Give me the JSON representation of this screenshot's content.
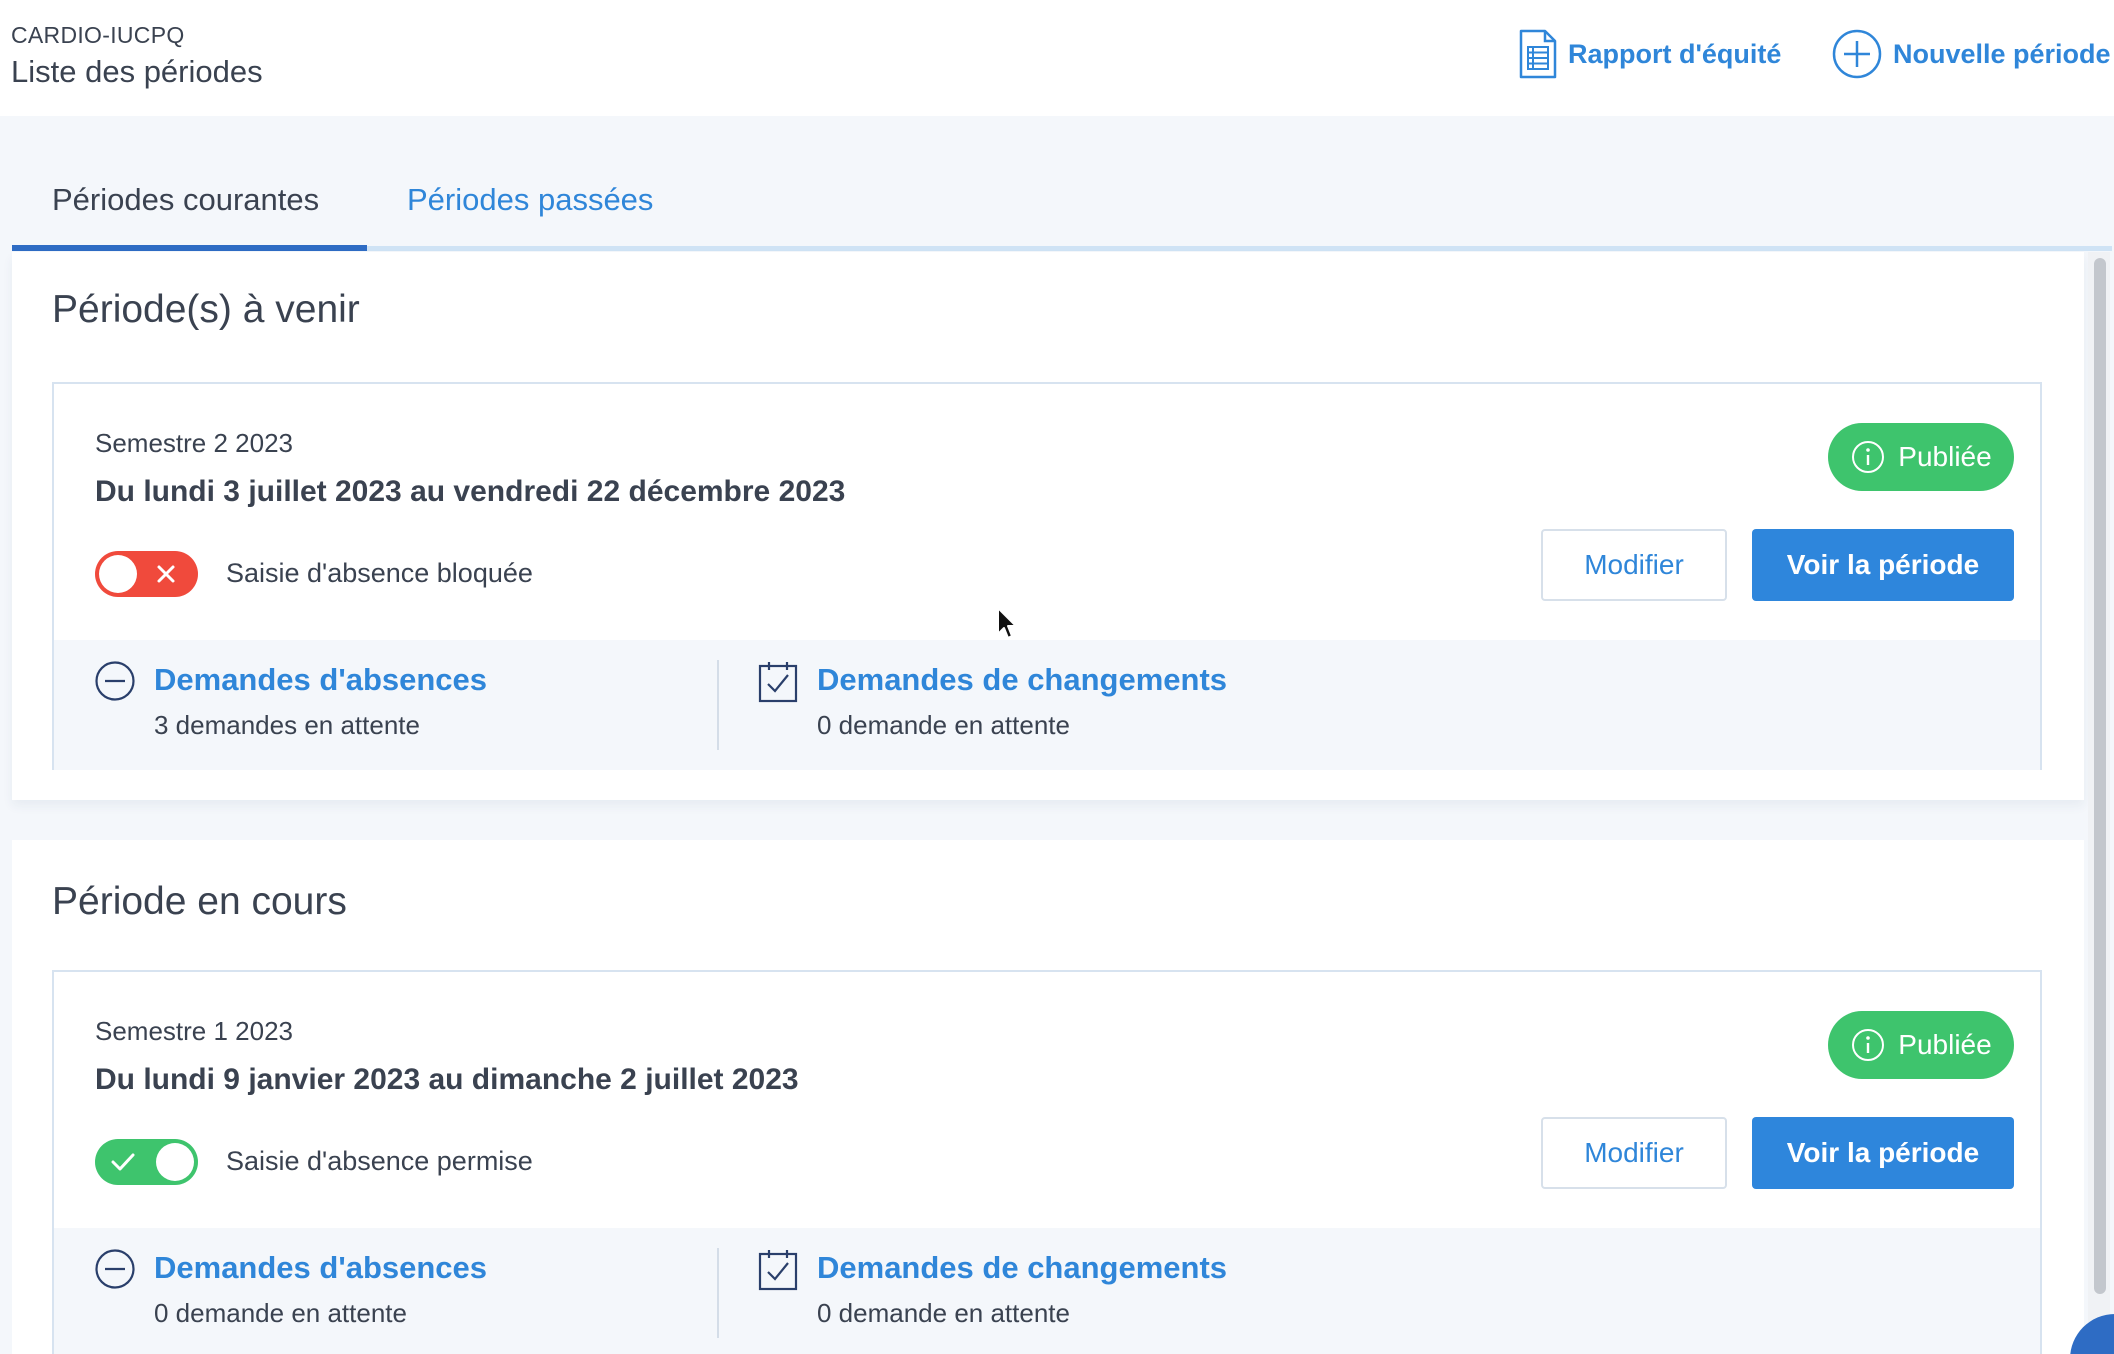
{
  "header": {
    "org": "CARDIO-IUCPQ",
    "title": "Liste des périodes",
    "equity_report_label": "Rapport d'équité",
    "new_period_label": "Nouvelle période"
  },
  "tabs": [
    {
      "label": "Périodes courantes",
      "active": true
    },
    {
      "label": "Périodes passées",
      "active": false
    }
  ],
  "sections": [
    {
      "title": "Période(s) à venir",
      "period": {
        "name": "Semestre 2 2023",
        "dates": "Du lundi 3 juillet 2023 au vendredi 22 décembre 2023",
        "absence_toggle": "off",
        "absence_label": "Saisie d'absence bloquée",
        "status": "Publiée",
        "edit_label": "Modifier",
        "view_label": "Voir la période",
        "absences_title": "Demandes d'absences",
        "absences_pending": "3 demandes en attente",
        "changes_title": "Demandes de changements",
        "changes_pending": "0 demande en attente"
      }
    },
    {
      "title": "Période en cours",
      "period": {
        "name": "Semestre 1 2023",
        "dates": "Du lundi 9 janvier 2023 au dimanche 2 juillet 2023",
        "absence_toggle": "on",
        "absence_label": "Saisie d'absence permise",
        "status": "Publiée",
        "edit_label": "Modifier",
        "view_label": "Voir la période",
        "absences_title": "Demandes d'absences",
        "absences_pending": "0 demande en attente",
        "changes_title": "Demandes de changements",
        "changes_pending": "0 demande en attente"
      }
    }
  ],
  "colors": {
    "accent": "#2f86d9",
    "primary_button": "#2e86dc",
    "published": "#3ec46d",
    "toggle_off": "#f04a3c",
    "toggle_on": "#3ec46d",
    "tab_underline": "#2e6cc4"
  },
  "icons": {
    "equity_report": "document-list-icon",
    "new_period": "plus-circle-icon",
    "status": "info-circle-icon",
    "absences": "minus-circle-icon",
    "changes": "calendar-check-icon"
  }
}
